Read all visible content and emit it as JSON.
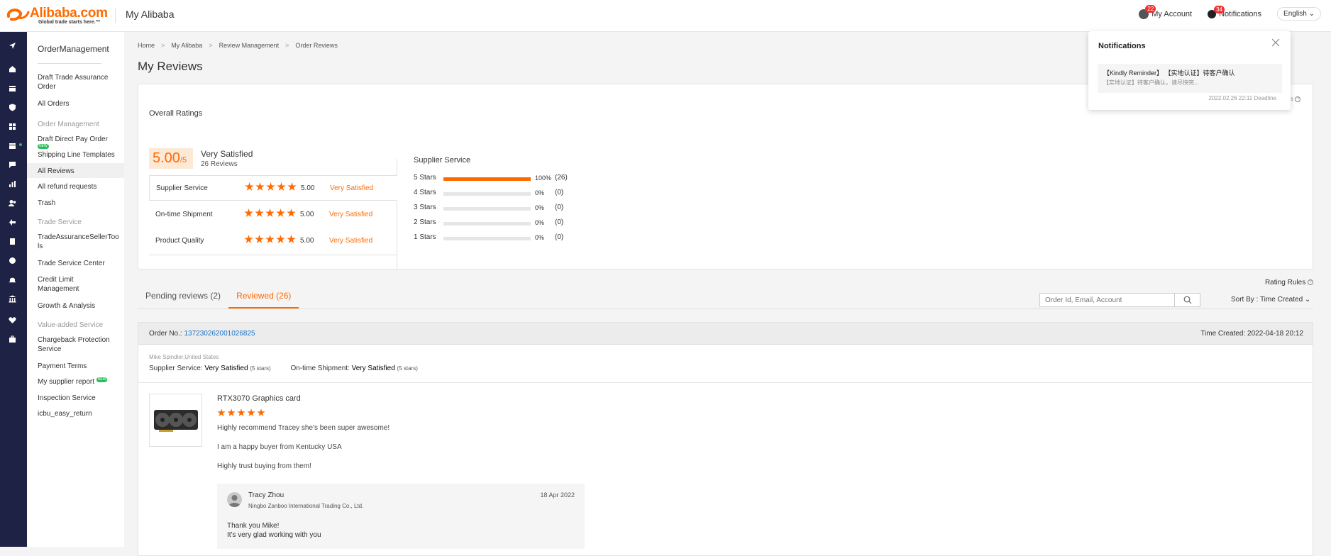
{
  "header": {
    "logo_text": "Alibaba.com",
    "logo_tagline": "Global trade starts here.™",
    "title": "My Alibaba",
    "account_label": "My Account",
    "account_badge": "22",
    "notifications_label": "Notifications",
    "notifications_badge": "34",
    "language": "English ⌄"
  },
  "rail_icons": [
    "send-icon",
    "home-icon",
    "store-icon",
    "shield-icon",
    "apps-icon",
    "order-icon",
    "chat-icon",
    "chart-icon",
    "users-icon",
    "logistics-icon",
    "document-icon",
    "globe-icon",
    "bell-icon",
    "bank-icon",
    "heart-icon",
    "briefcase-icon"
  ],
  "leftnav": {
    "heading": "OrderManagement",
    "items": [
      {
        "label": "Draft Trade Assurance Order"
      },
      {
        "label": "All Orders"
      },
      {
        "label": "Order Management"
      },
      {
        "label": "Draft Direct Pay Order",
        "badge": "NEW"
      },
      {
        "label": "Shipping Line Templates"
      },
      {
        "label": "All Reviews"
      },
      {
        "label": "All refund requests"
      },
      {
        "label": "Trash"
      },
      {
        "label": "Trade Service"
      },
      {
        "label": "TradeAssuranceSellerTools"
      },
      {
        "label": "Trade Service Center"
      },
      {
        "label": "Credit Limit Management"
      },
      {
        "label": "Growth & Analysis"
      },
      {
        "label": "Value-added Service"
      },
      {
        "label": "Chargeback Protection Service"
      },
      {
        "label": "Payment Terms"
      },
      {
        "label": "My supplier report",
        "badge": "NEW"
      },
      {
        "label": "Inspection Service"
      },
      {
        "label": "icbu_easy_return"
      }
    ]
  },
  "breadcrumb": [
    "Home",
    "My Alibaba",
    "Review Management",
    "Order Reviews"
  ],
  "page_title": "My Reviews",
  "overall": {
    "title": "Overall Ratings",
    "score": "5.00",
    "score_max": "/5",
    "summary": "Very Satisfied",
    "count": "26 Reviews",
    "rows": [
      {
        "label": "Supplier Service",
        "stars": 5,
        "value": "5.00",
        "text": "Very Satisfied"
      },
      {
        "label": "On-time Shipment",
        "stars": 5,
        "value": "5.00",
        "text": "Very Satisfied"
      },
      {
        "label": "Product Quality",
        "stars": 5,
        "value": "5.00",
        "text": "Very Satisfied"
      }
    ]
  },
  "supplier_service": {
    "title": "Supplier Service",
    "rows": [
      {
        "label": "5 Stars",
        "fraction": 1.0,
        "pct": "100%",
        "count": "(26)"
      },
      {
        "label": "4 Stars",
        "fraction": 0,
        "pct": "0%",
        "count": "(0)"
      },
      {
        "label": "3 Stars",
        "fraction": 0,
        "pct": "0%",
        "count": "(0)"
      },
      {
        "label": "2 Stars",
        "fraction": 0,
        "pct": "0%",
        "count": "(0)"
      },
      {
        "label": "1 Stars",
        "fraction": 0,
        "pct": "0%",
        "count": "(0)"
      }
    ]
  },
  "rating_rules": "Rating Rules",
  "tabs": [
    {
      "label": "Pending reviews (2)"
    },
    {
      "label": "Reviewed (26)"
    }
  ],
  "search": {
    "placeholder": "Order Id, Email, Account",
    "value": ""
  },
  "sort_label": "Sort By : Time Created ⌄",
  "order": {
    "no_label": "Order No.:",
    "no": "137230262001026825",
    "time_created": "Time Created: 2022-04-18 20:12",
    "buyer": "Mike Spindler,United States",
    "supplier_service_label": "Supplier Service:",
    "supplier_service_value": "Very Satisfied",
    "supplier_service_stars": "(5 stars)",
    "shipment_label": "On-time Shipment:",
    "shipment_value": "Very Satisfied",
    "shipment_stars": "(5 stars)",
    "product": "RTX3070 Graphics card",
    "product_stars": 5,
    "review_lines": [
      "Highly recommend Tracey she's been super awesome!",
      "I am a happy buyer from Kentucky USA",
      "Highly trust buying from them!"
    ],
    "reply": {
      "name": "Tracy Zhou",
      "company": "Ningbo Zanboo International Trading Co., Ltd.",
      "date": "18 Apr 2022",
      "line1": "Thank you Mike!",
      "line2": "It's very glad working with you"
    }
  },
  "notification_popup": {
    "title": "Notifications",
    "message_title": "【Kindly Reminder】 【实地认证】待客户确认",
    "message_body": "【实地认证】待客户确认，请尽快完...",
    "deadline": "2022.02.26 22:11 Deadline"
  },
  "colors": {
    "accent": "#ff6a00",
    "rail": "#1e2244",
    "link": "#1a73c8"
  }
}
